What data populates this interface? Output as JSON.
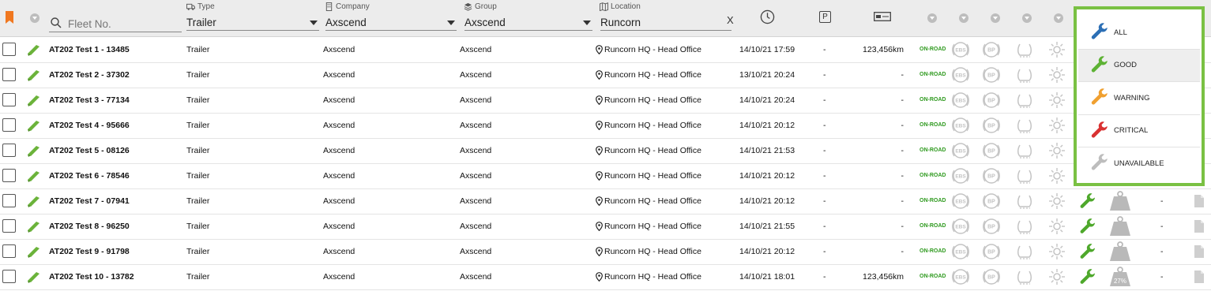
{
  "header": {
    "search_placeholder": "Fleet No.",
    "type_label": "Type",
    "type_value": "Trailer",
    "company_label": "Company",
    "company_value": "Axscend",
    "group_label": "Group",
    "group_value": "Axscend",
    "location_label": "Location",
    "location_value": "Runcorn",
    "clear_label": "X",
    "parking_label": "P"
  },
  "colors": {
    "accent": "#7ac143",
    "good": "#5db234",
    "warning": "#f0a030",
    "critical": "#d93232",
    "unavailable": "#bdbdbd",
    "bookmark": "#f07820",
    "onroad": "#2f9a1f"
  },
  "rows": [
    {
      "name": "AT202 Test 1 - 13485",
      "type": "Trailer",
      "company": "Axscend",
      "group": "Axscend",
      "location": "Runcorn HQ - Head Office",
      "time": "14/10/21 17:59",
      "parking": "-",
      "odometer": "123,456km",
      "status": "ON-ROAD",
      "ebs": "EBS",
      "bp": "BP",
      "extra": "",
      "load": ""
    },
    {
      "name": "AT202 Test 2 - 37302",
      "type": "Trailer",
      "company": "Axscend",
      "group": "Axscend",
      "location": "Runcorn HQ - Head Office",
      "time": "13/10/21 20:24",
      "parking": "-",
      "odometer": "-",
      "status": "ON-ROAD",
      "ebs": "EBS",
      "bp": "BP",
      "extra": "",
      "load": ""
    },
    {
      "name": "AT202 Test 3 - 77134",
      "type": "Trailer",
      "company": "Axscend",
      "group": "Axscend",
      "location": "Runcorn HQ - Head Office",
      "time": "14/10/21 20:24",
      "parking": "-",
      "odometer": "-",
      "status": "ON-ROAD",
      "ebs": "EBS",
      "bp": "BP",
      "extra": "",
      "load": ""
    },
    {
      "name": "AT202 Test 4 - 95666",
      "type": "Trailer",
      "company": "Axscend",
      "group": "Axscend",
      "location": "Runcorn HQ - Head Office",
      "time": "14/10/21 20:12",
      "parking": "-",
      "odometer": "-",
      "status": "ON-ROAD",
      "ebs": "EBS",
      "bp": "BP",
      "extra": "",
      "load": ""
    },
    {
      "name": "AT202 Test 5 - 08126",
      "type": "Trailer",
      "company": "Axscend",
      "group": "Axscend",
      "location": "Runcorn HQ - Head Office",
      "time": "14/10/21 21:53",
      "parking": "-",
      "odometer": "-",
      "status": "ON-ROAD",
      "ebs": "EBS",
      "bp": "BP",
      "extra": "",
      "load": ""
    },
    {
      "name": "AT202 Test 6 - 78546",
      "type": "Trailer",
      "company": "Axscend",
      "group": "Axscend",
      "location": "Runcorn HQ - Head Office",
      "time": "14/10/21 20:12",
      "parking": "-",
      "odometer": "-",
      "status": "ON-ROAD",
      "ebs": "EBS",
      "bp": "BP",
      "extra": "",
      "load": ""
    },
    {
      "name": "AT202 Test 7 - 07941",
      "type": "Trailer",
      "company": "Axscend",
      "group": "Axscend",
      "location": "Runcorn HQ - Head Office",
      "time": "14/10/21 20:12",
      "parking": "-",
      "odometer": "-",
      "status": "ON-ROAD",
      "ebs": "EBS",
      "bp": "BP",
      "extra": "-",
      "load": ""
    },
    {
      "name": "AT202 Test 8 - 96250",
      "type": "Trailer",
      "company": "Axscend",
      "group": "Axscend",
      "location": "Runcorn HQ - Head Office",
      "time": "14/10/21 21:55",
      "parking": "-",
      "odometer": "-",
      "status": "ON-ROAD",
      "ebs": "EBS",
      "bp": "BP",
      "extra": "-",
      "load": ""
    },
    {
      "name": "AT202 Test 9 - 91798",
      "type": "Trailer",
      "company": "Axscend",
      "group": "Axscend",
      "location": "Runcorn HQ - Head Office",
      "time": "14/10/21 20:12",
      "parking": "-",
      "odometer": "-",
      "status": "ON-ROAD",
      "ebs": "EBS",
      "bp": "BP",
      "extra": "-",
      "load": ""
    },
    {
      "name": "AT202 Test 10 - 13782",
      "type": "Trailer",
      "company": "Axscend",
      "group": "Axscend",
      "location": "Runcorn HQ - Head Office",
      "time": "14/10/21 18:01",
      "parking": "-",
      "odometer": "123,456km",
      "status": "ON-ROAD",
      "ebs": "EBS",
      "bp": "BP",
      "extra": "-",
      "load": "27%"
    }
  ],
  "filter_menu": {
    "options": [
      {
        "label": "ALL",
        "color": "#2c6fb5",
        "selected": false
      },
      {
        "label": "GOOD",
        "color": "#5db234",
        "selected": true
      },
      {
        "label": "WARNING",
        "color": "#f0a030",
        "selected": false
      },
      {
        "label": "CRITICAL",
        "color": "#d93232",
        "selected": false
      },
      {
        "label": "UNAVAILABLE",
        "color": "#bdbdbd",
        "selected": false
      }
    ]
  }
}
